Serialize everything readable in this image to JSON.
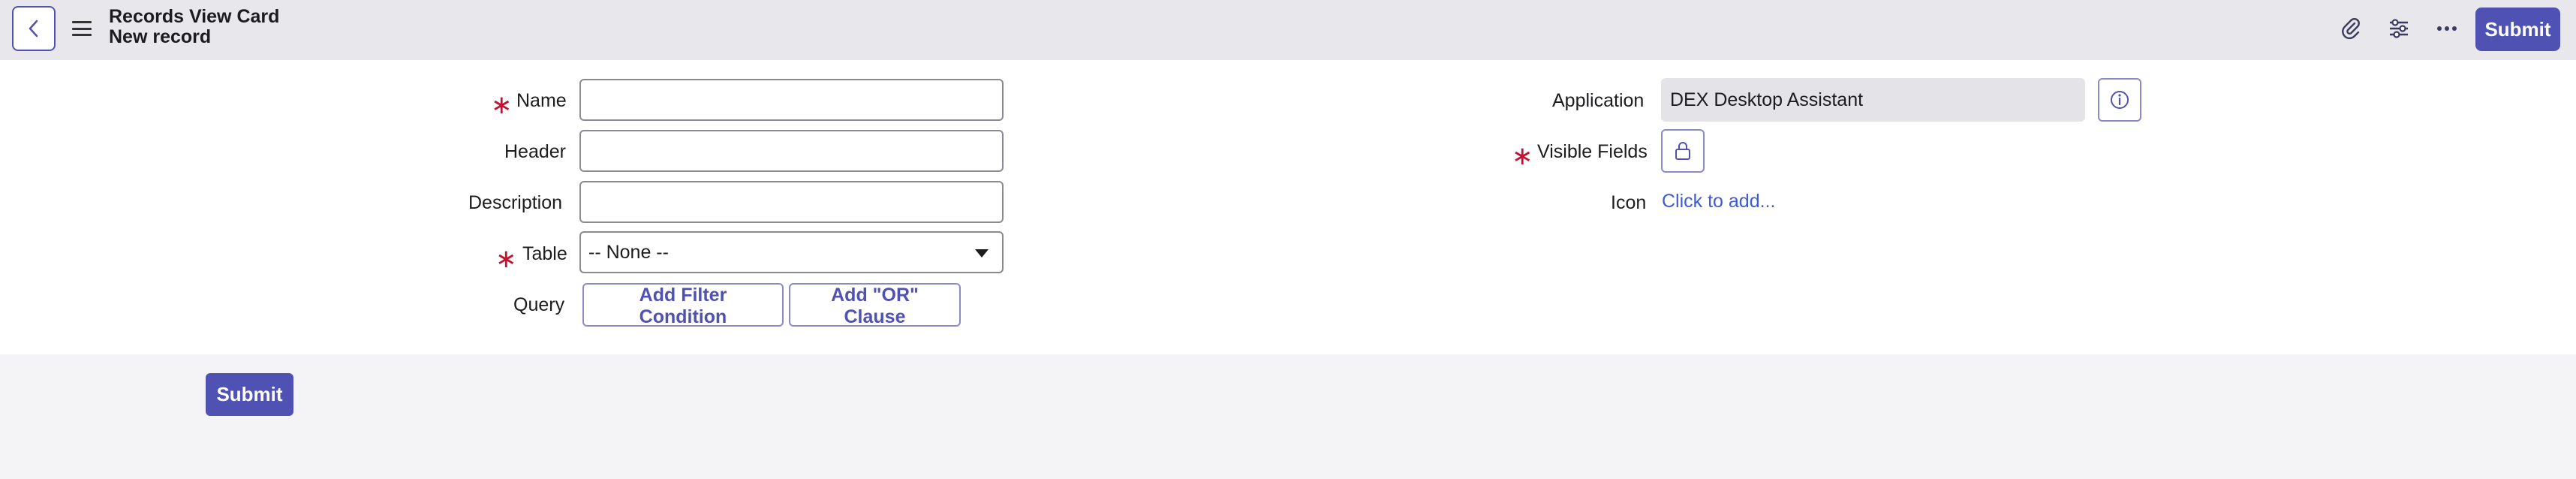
{
  "header": {
    "title": "Records View Card",
    "subtitle": "New record",
    "back_icon": "chevron-left-icon",
    "menu_icon": "hamburger-menu-icon",
    "attachment_icon": "paperclip-icon",
    "settings_icon": "sliders-icon",
    "more_icon": "more-horizontal-icon",
    "submit_label": "Submit"
  },
  "form": {
    "name": {
      "label": "Name",
      "required": true,
      "value": ""
    },
    "header": {
      "label": "Header",
      "value": ""
    },
    "description": {
      "label": "Description",
      "value": ""
    },
    "table": {
      "label": "Table",
      "required": true,
      "selected": "-- None --"
    },
    "query": {
      "label": "Query",
      "add_filter_label": "Add Filter Condition",
      "add_or_label": "Add \"OR\" Clause"
    },
    "application": {
      "label": "Application",
      "value": "DEX Desktop Assistant",
      "info_icon": "info-icon"
    },
    "visible_fields": {
      "label": "Visible Fields",
      "required": true,
      "lock_icon": "lock-icon"
    },
    "icon": {
      "label": "Icon",
      "link": "Click to add..."
    }
  },
  "footer": {
    "submit_label": "Submit"
  },
  "colors": {
    "accent": "#4f52b2",
    "required": "#c8102e",
    "link": "#3d5bd9"
  }
}
